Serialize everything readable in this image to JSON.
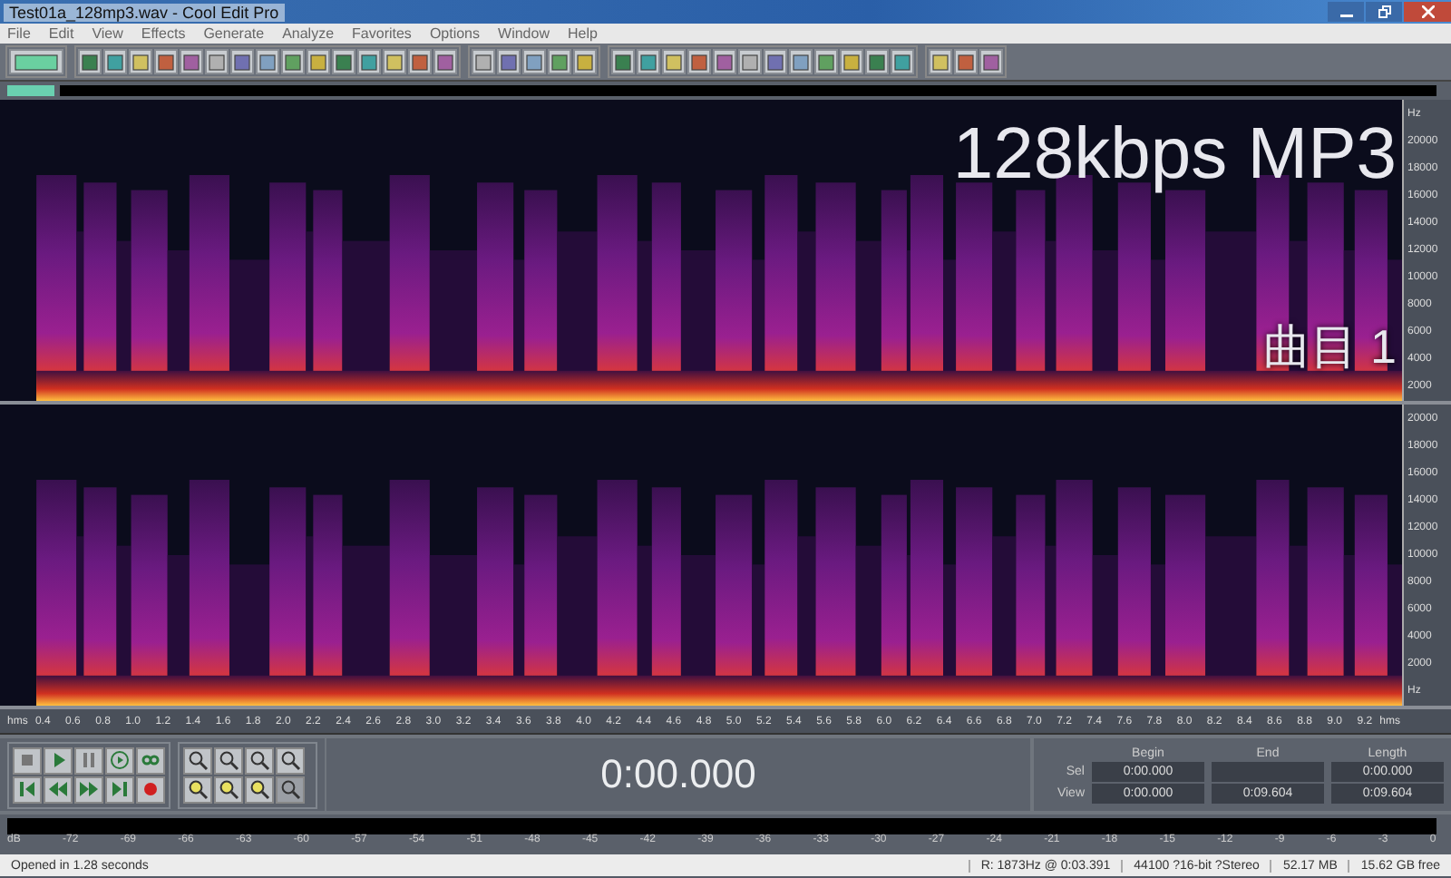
{
  "window": {
    "title": "Test01a_128mp3.wav - Cool Edit Pro"
  },
  "menu": [
    "File",
    "Edit",
    "View",
    "Effects",
    "Generate",
    "Analyze",
    "Favorites",
    "Options",
    "Window",
    "Help"
  ],
  "channels": [
    {
      "freq_labels": [
        "Hz",
        "20000",
        "18000",
        "16000",
        "14000",
        "12000",
        "10000",
        "8000",
        "6000",
        "4000",
        "2000"
      ],
      "overlays": [
        {
          "kind": "title",
          "text": "128kbps MP3"
        },
        {
          "kind": "label",
          "text": "曲目 1"
        }
      ]
    },
    {
      "freq_labels": [
        "20000",
        "18000",
        "16000",
        "14000",
        "12000",
        "10000",
        "8000",
        "6000",
        "4000",
        "2000",
        "Hz"
      ]
    }
  ],
  "time_ruler": {
    "unit_start": "hms",
    "ticks": [
      "0.4",
      "0.6",
      "0.8",
      "1.0",
      "1.2",
      "1.4",
      "1.6",
      "1.8",
      "2.0",
      "2.2",
      "2.4",
      "2.6",
      "2.8",
      "3.0",
      "3.2",
      "3.4",
      "3.6",
      "3.8",
      "4.0",
      "4.2",
      "4.4",
      "4.6",
      "4.8",
      "5.0",
      "5.2",
      "5.4",
      "5.6",
      "5.8",
      "6.0",
      "6.2",
      "6.4",
      "6.6",
      "6.8",
      "7.0",
      "7.2",
      "7.4",
      "7.6",
      "7.8",
      "8.0",
      "8.2",
      "8.4",
      "8.6",
      "8.8",
      "9.0",
      "9.2"
    ],
    "unit_end": "hms"
  },
  "transport": {
    "time": "0:00.000"
  },
  "selection": {
    "headers": [
      "Begin",
      "End",
      "Length"
    ],
    "rows": [
      {
        "label": "Sel",
        "begin": "0:00.000",
        "length": "0:00.000"
      },
      {
        "label": "View",
        "begin": "0:00.000",
        "end": "0:09.604",
        "length": "0:09.604"
      }
    ]
  },
  "level_meter": {
    "ticks": [
      "dB",
      "-72",
      "-69",
      "-66",
      "-63",
      "-60",
      "-57",
      "-54",
      "-51",
      "-48",
      "-45",
      "-42",
      "-39",
      "-36",
      "-33",
      "-30",
      "-27",
      "-24",
      "-21",
      "-18",
      "-15",
      "-12",
      "-9",
      "-6",
      "-3",
      "0"
    ]
  },
  "status_bar": [
    "Opened in 1.28 seconds",
    "R: 1873Hz @  0:03.391",
    "44100 ?16-bit ?Stereo",
    "52.17 MB",
    "15.62 GB free"
  ]
}
